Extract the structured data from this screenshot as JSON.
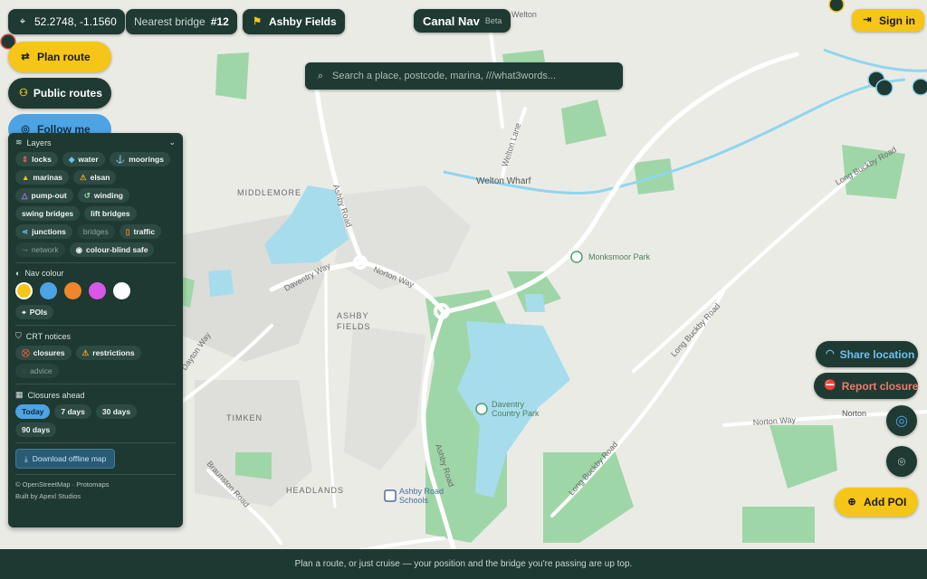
{
  "topbar": {
    "coordinates": "52.2748, -1.1560",
    "nearest_bridge_label": "Nearest bridge",
    "nearest_bridge_number": "#12",
    "place": "Ashby Fields",
    "app_title": "Canal Nav",
    "app_badge": "Beta",
    "sign_in": "Sign in"
  },
  "left_actions": {
    "plan_route": "Plan route",
    "public_routes": "Public routes",
    "follow_me": "Follow me"
  },
  "search": {
    "placeholder": "Search a place, postcode, marina, ///what3words..."
  },
  "panel": {
    "layers_title": "Layers",
    "layers": [
      {
        "label": "locks",
        "icon": "lock-icon",
        "active": true
      },
      {
        "label": "water",
        "icon": "water-drop-icon",
        "active": true
      },
      {
        "label": "moorings",
        "icon": "anchor-icon",
        "active": true
      },
      {
        "label": "marinas",
        "icon": "marina-icon",
        "active": true
      },
      {
        "label": "elsan",
        "icon": "warning-triangle-icon",
        "active": true
      },
      {
        "label": "pump-out",
        "icon": "pump-out-icon",
        "active": true
      },
      {
        "label": "winding",
        "icon": "winding-icon",
        "active": true
      },
      {
        "label": "swing bridges",
        "icon": "",
        "active": true
      },
      {
        "label": "lift bridges",
        "icon": "",
        "active": true
      },
      {
        "label": "junctions",
        "icon": "junction-icon",
        "active": true
      },
      {
        "label": "bridges",
        "icon": "",
        "active": false
      },
      {
        "label": "traffic",
        "icon": "traffic-icon",
        "active": true
      },
      {
        "label": "network",
        "icon": "network-icon",
        "active": false
      },
      {
        "label": "colour-blind safe",
        "icon": "eye-icon",
        "active": true
      }
    ],
    "nav_colour_title": "Nav colour",
    "nav_colours": [
      "#f5c518",
      "#4da3e3",
      "#f0862a",
      "#d957e8",
      "#ffffff"
    ],
    "pois_label": "POIs",
    "crt_title": "CRT notices",
    "crt_notices": [
      {
        "label": "closures",
        "icon": "closure-icon",
        "active": true
      },
      {
        "label": "restrictions",
        "icon": "warning-triangle-icon",
        "active": true
      },
      {
        "label": "advice",
        "icon": "advice-icon",
        "active": false
      }
    ],
    "closures_title": "Closures ahead",
    "closure_ranges": [
      {
        "label": "Today",
        "selected": true
      },
      {
        "label": "7 days",
        "selected": false
      },
      {
        "label": "30 days",
        "selected": false
      },
      {
        "label": "90 days",
        "selected": false
      }
    ],
    "download": "Download offline map",
    "attribution": "© OpenStreetMap · Protomaps",
    "credit": "Built by Apexl Studios"
  },
  "right_actions": {
    "share_location": "Share location",
    "report_closure": "Report closure",
    "add_poi": "Add POI"
  },
  "map_labels": {
    "welton_top": "Welton",
    "welton_lane": "Welton Lane",
    "welton_wharf": "Welton Wharf",
    "middlemore": "MIDDLEMORE",
    "ashby_road_top": "Ashby Road",
    "norton_way_1": "Norton Way",
    "daventry_way": "Daventry Way",
    "monksmoor_park": "Monksmoor Park",
    "ashby_fields_1": "ASHBY",
    "ashby_fields_2": "FIELDS",
    "long_buckby_road_1": "Long Buckby Road",
    "long_buckby_road_2": "Long Buckby Road",
    "long_buckby_road_3": "Long Buckby Road",
    "norton_way_2": "Norton Way",
    "norton": "Norton",
    "daventry_cp_1": "Daventry",
    "daventry_cp_2": "Country Park",
    "timken": "TIMKEN",
    "headlands": "HEADLANDS",
    "braunston_road": "Braunston Road",
    "ashby_school_1": "Ashby Road",
    "ashby_school_2": "Schools",
    "ashby_road_bottom": "Ashby Road",
    "dayton_way": "Dayton Way"
  },
  "footer": {
    "hint": "Plan a route, or just cruise — your position and the bridge you're passing are up top."
  },
  "colors": {
    "panel_bg": "#1e3832",
    "accent_yellow": "#f5c518",
    "accent_blue": "#4da3e3",
    "water": "#a7dced",
    "park": "#9fd6a8",
    "danger": "#e0574a"
  }
}
